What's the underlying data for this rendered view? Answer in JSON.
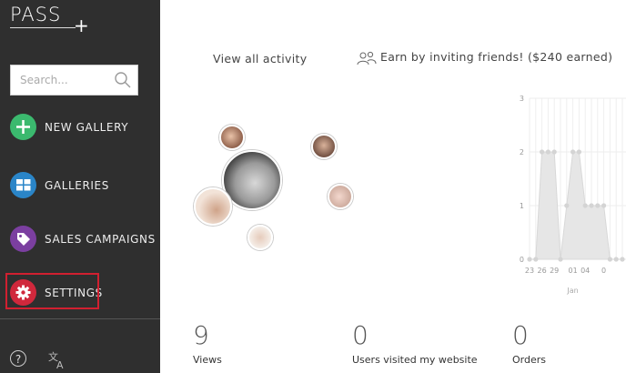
{
  "app": {
    "logo_text": "PASS",
    "logo_plus": "+"
  },
  "search": {
    "placeholder": "Search..."
  },
  "sidebar": {
    "items": [
      {
        "label": "NEW GALLERY",
        "icon": "plus-icon",
        "color": "#3bb96e"
      },
      {
        "label": "GALLERIES",
        "icon": "grid-icon",
        "color": "#2a85c8"
      },
      {
        "label": "SALES CAMPAIGNS",
        "icon": "tag-icon",
        "color": "#7b3fa0"
      },
      {
        "label": "SETTINGS",
        "icon": "gear-icon",
        "color": "#d0283c"
      }
    ],
    "help_label": "?",
    "language_icon": "translate-icon"
  },
  "header": {
    "activity_link": "View all activity",
    "invite_text": "Earn by inviting friends! ($240 earned)"
  },
  "stats": [
    {
      "value": "9",
      "label": "Views"
    },
    {
      "value": "0",
      "label": "Users visited my website"
    },
    {
      "value": "0",
      "label": "Orders"
    }
  ],
  "chart_data": {
    "type": "area",
    "x": [
      "23",
      "",
      "26",
      "",
      "",
      "29",
      "",
      "01",
      "",
      "",
      "04",
      "",
      "0"
    ],
    "tick_labels_x": [
      "23",
      "26",
      "29",
      "01",
      "04",
      "0"
    ],
    "month_label": "Jan",
    "y_ticks": [
      "0",
      "1",
      "2",
      "3"
    ],
    "ylim": [
      0,
      3
    ],
    "series": [
      {
        "values": [
          0,
          0,
          2,
          2,
          2,
          0,
          1,
          2,
          2,
          1,
          1,
          1,
          1,
          0,
          0,
          0
        ]
      }
    ],
    "color": "#e6e6e6",
    "grid": true
  }
}
